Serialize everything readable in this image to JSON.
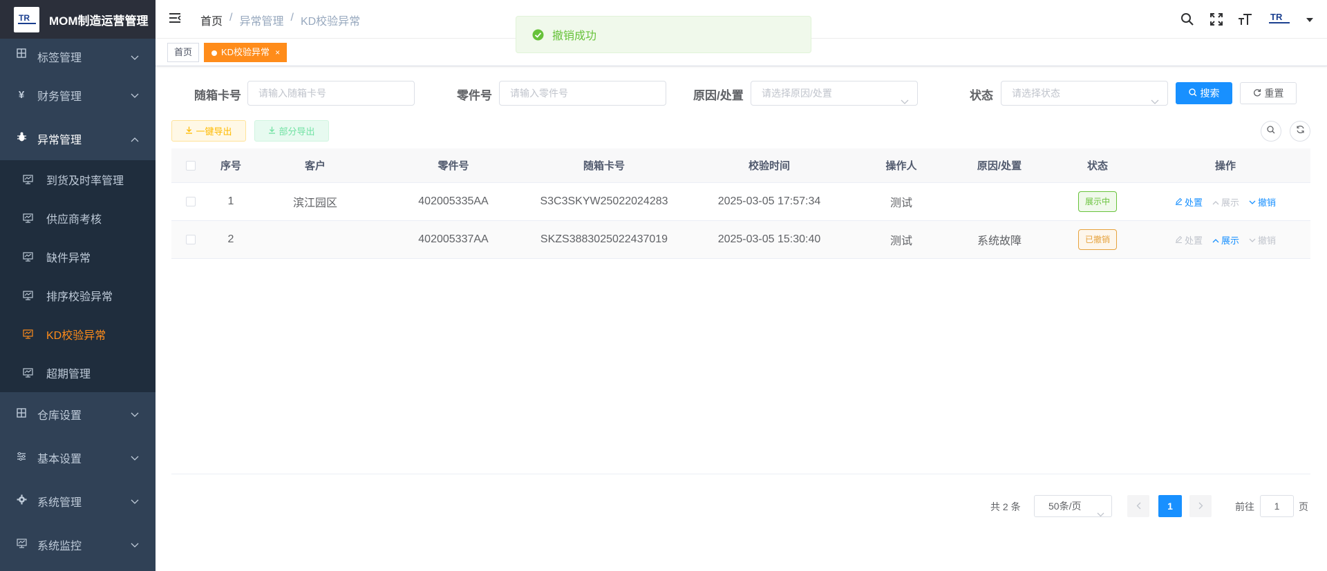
{
  "app": {
    "title": "MOM制造运营管理",
    "logo_text": "TR"
  },
  "sidebar": {
    "items": [
      {
        "label": "标签管理",
        "icon": "grid-icon"
      },
      {
        "label": "财务管理",
        "icon": "yen-icon"
      },
      {
        "label": "异常管理",
        "icon": "bug-icon",
        "open": true
      },
      {
        "label": "仓库设置",
        "icon": "grid-icon"
      },
      {
        "label": "基本设置",
        "icon": "sliders-icon"
      },
      {
        "label": "系统管理",
        "icon": "gear-icon"
      },
      {
        "label": "系统监控",
        "icon": "monitor-icon"
      }
    ],
    "sub_items": [
      {
        "label": "到货及时率管理"
      },
      {
        "label": "供应商考核"
      },
      {
        "label": "缺件异常"
      },
      {
        "label": "排序校验异常"
      },
      {
        "label": "KD校验异常",
        "active": true
      },
      {
        "label": "超期管理"
      }
    ]
  },
  "navbar": {
    "breadcrumb": [
      "首页",
      "异常管理",
      "KD校验异常"
    ],
    "separator": "/"
  },
  "tags": {
    "home": "首页",
    "current": "KD校验异常",
    "close": "×"
  },
  "toast": {
    "message": "撤销成功"
  },
  "search_form": {
    "card_label": "随箱卡号",
    "card_placeholder": "请输入随箱卡号",
    "part_label": "零件号",
    "part_placeholder": "请输入零件号",
    "reason_label": "原因/处置",
    "reason_placeholder": "请选择原因/处置",
    "status_label": "状态",
    "status_placeholder": "请选择状态",
    "search_button": "搜索",
    "reset_button": "重置"
  },
  "toolbar": {
    "export_all": "一键导出",
    "export_part": "部分导出"
  },
  "table": {
    "columns": [
      "序号",
      "客户",
      "零件号",
      "随箱卡号",
      "校验时间",
      "操作人",
      "原因/处置",
      "状态",
      "操作"
    ],
    "rows": [
      {
        "index": "1",
        "customer": "滨江园区",
        "part_no": "402005335AA",
        "card_no": "S3C3SKYW25022024283",
        "check_time": "2025-03-05 17:57:34",
        "operator": "测试",
        "reason": "",
        "status": "展示中",
        "status_color": "#67c23a"
      },
      {
        "index": "2",
        "customer": "",
        "part_no": "402005337AA",
        "card_no": "SKZS3883025022437019",
        "check_time": "2025-03-05 15:30:40",
        "operator": "测试",
        "reason": "系统故障",
        "status": "已撤销",
        "status_color": "#e6a23c"
      }
    ],
    "actions": {
      "handle": "处置",
      "show": "展示",
      "revoke": "撤销"
    }
  },
  "pagination": {
    "total_text": "共 2 条",
    "page_size": "50条/页",
    "current_page": "1",
    "goto_prefix": "前往",
    "goto_value": "1",
    "goto_suffix": "页"
  },
  "colors": {
    "accent": "#1890ff",
    "active_menu": "#ff8c1a",
    "sidebar_bg": "#304156",
    "success": "#67c23a",
    "warning": "#e6a23c"
  }
}
